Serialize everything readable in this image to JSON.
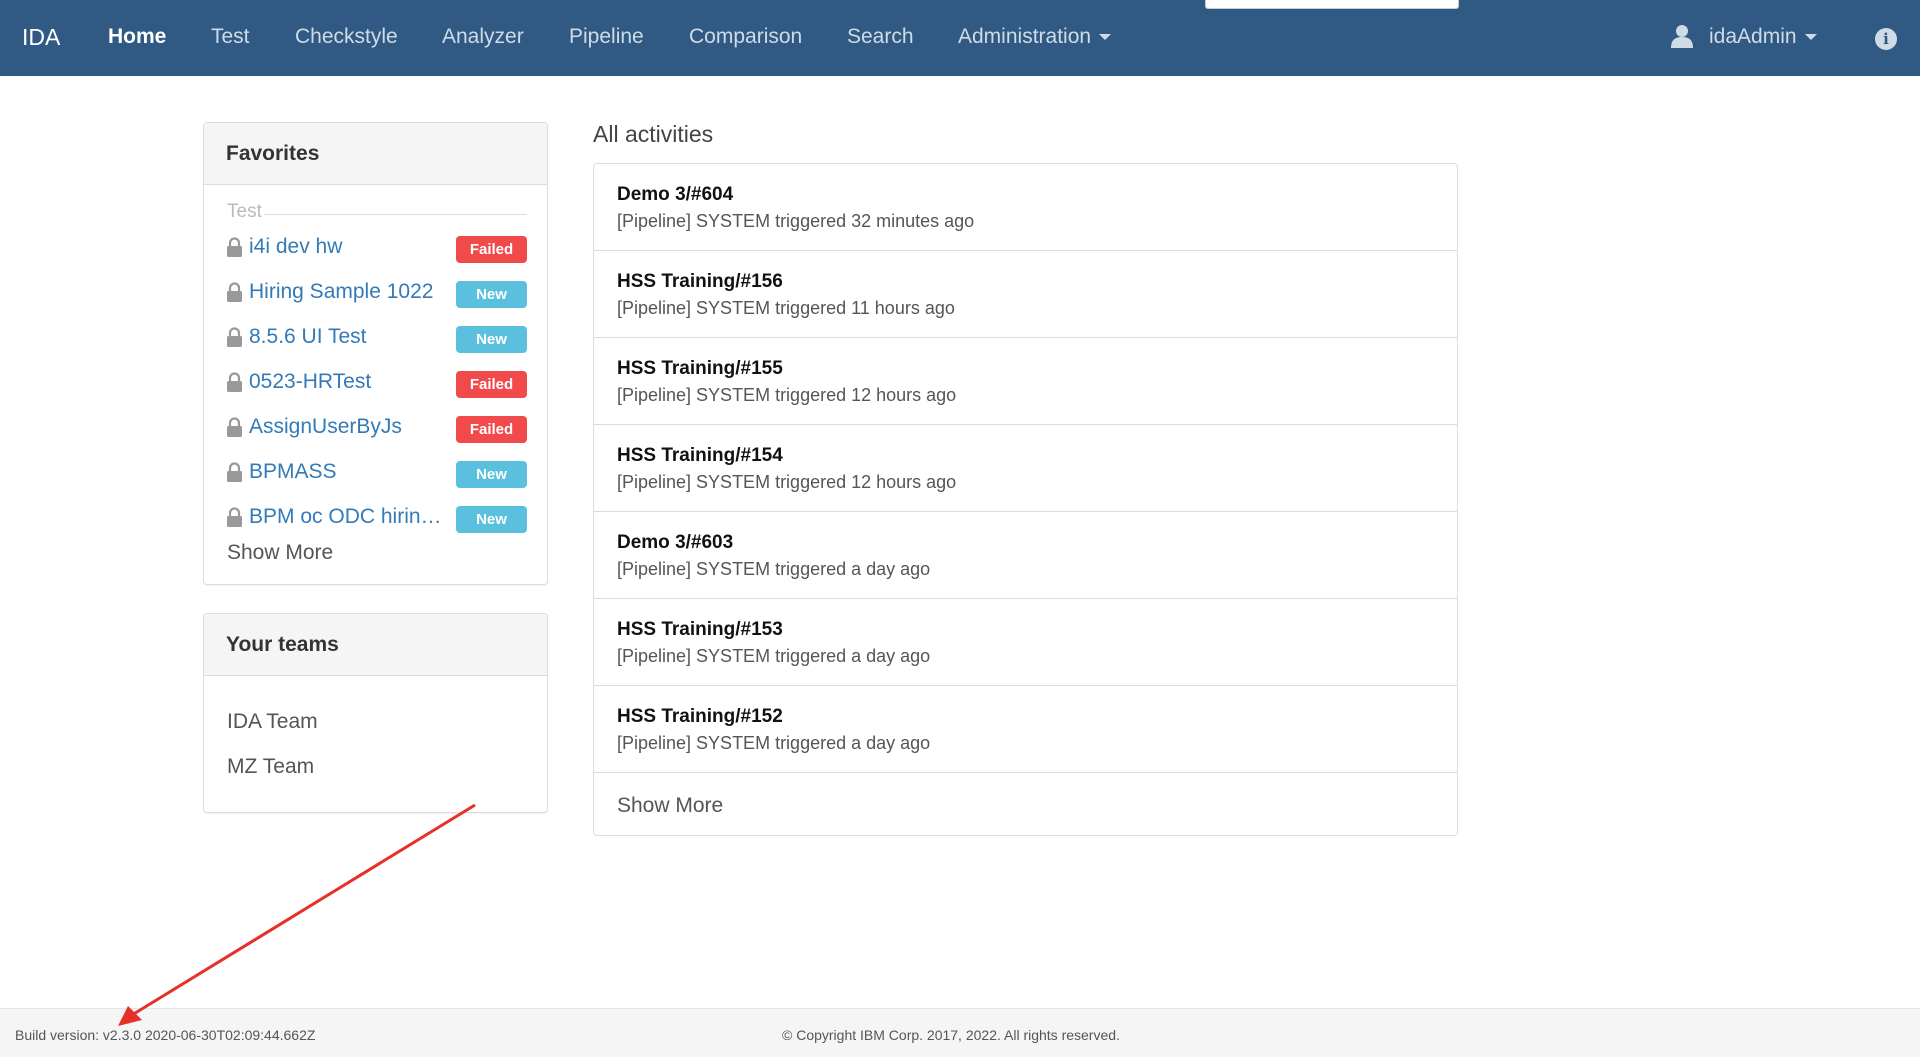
{
  "navbar": {
    "brand": "IDA",
    "links": [
      "Home",
      "Test",
      "Checkstyle",
      "Analyzer",
      "Pipeline",
      "Comparison",
      "Search",
      "Administration"
    ],
    "user": "idaAdmin",
    "info_icon": "i",
    "bg_color": "#305a83"
  },
  "favorites": {
    "heading": "Favorites",
    "group_label": "Test",
    "items": [
      {
        "name": "i4i dev hw",
        "status": "Failed"
      },
      {
        "name": "Hiring Sample 1022",
        "status": "New"
      },
      {
        "name": "8.5.6 UI Test",
        "status": "New"
      },
      {
        "name": "0523-HRTest",
        "status": "Failed"
      },
      {
        "name": "AssignUserByJs",
        "status": "Failed"
      },
      {
        "name": "BPMASS",
        "status": "New"
      },
      {
        "name": "BPM oc ODC hiring...",
        "status": "New"
      }
    ],
    "show_more": "Show More"
  },
  "teams": {
    "heading": "Your teams",
    "items": [
      "IDA Team",
      "MZ Team"
    ]
  },
  "activities": {
    "title": "All activities",
    "items": [
      {
        "title": "Demo 3/#604",
        "desc": "[Pipeline] SYSTEM triggered 32 minutes ago"
      },
      {
        "title": "HSS Training/#156",
        "desc": "[Pipeline] SYSTEM triggered 11 hours ago"
      },
      {
        "title": "HSS Training/#155",
        "desc": "[Pipeline] SYSTEM triggered 12 hours ago"
      },
      {
        "title": "HSS Training/#154",
        "desc": "[Pipeline] SYSTEM triggered 12 hours ago"
      },
      {
        "title": "Demo 3/#603",
        "desc": "[Pipeline] SYSTEM triggered a day ago"
      },
      {
        "title": "HSS Training/#153",
        "desc": "[Pipeline] SYSTEM triggered a day ago"
      },
      {
        "title": "HSS Training/#152",
        "desc": "[Pipeline] SYSTEM triggered a day ago"
      }
    ],
    "show_more": "Show More"
  },
  "footer": {
    "build": "Build version: v2.3.0 2020-06-30T02:09:44.662Z",
    "copyright": "© Copyright IBM Corp. 2017, 2022. All rights reserved."
  },
  "colors": {
    "failed": "#f04a4a",
    "new": "#5bc0de",
    "link": "#337ab7",
    "annotation_arrow": "#e8302a"
  }
}
